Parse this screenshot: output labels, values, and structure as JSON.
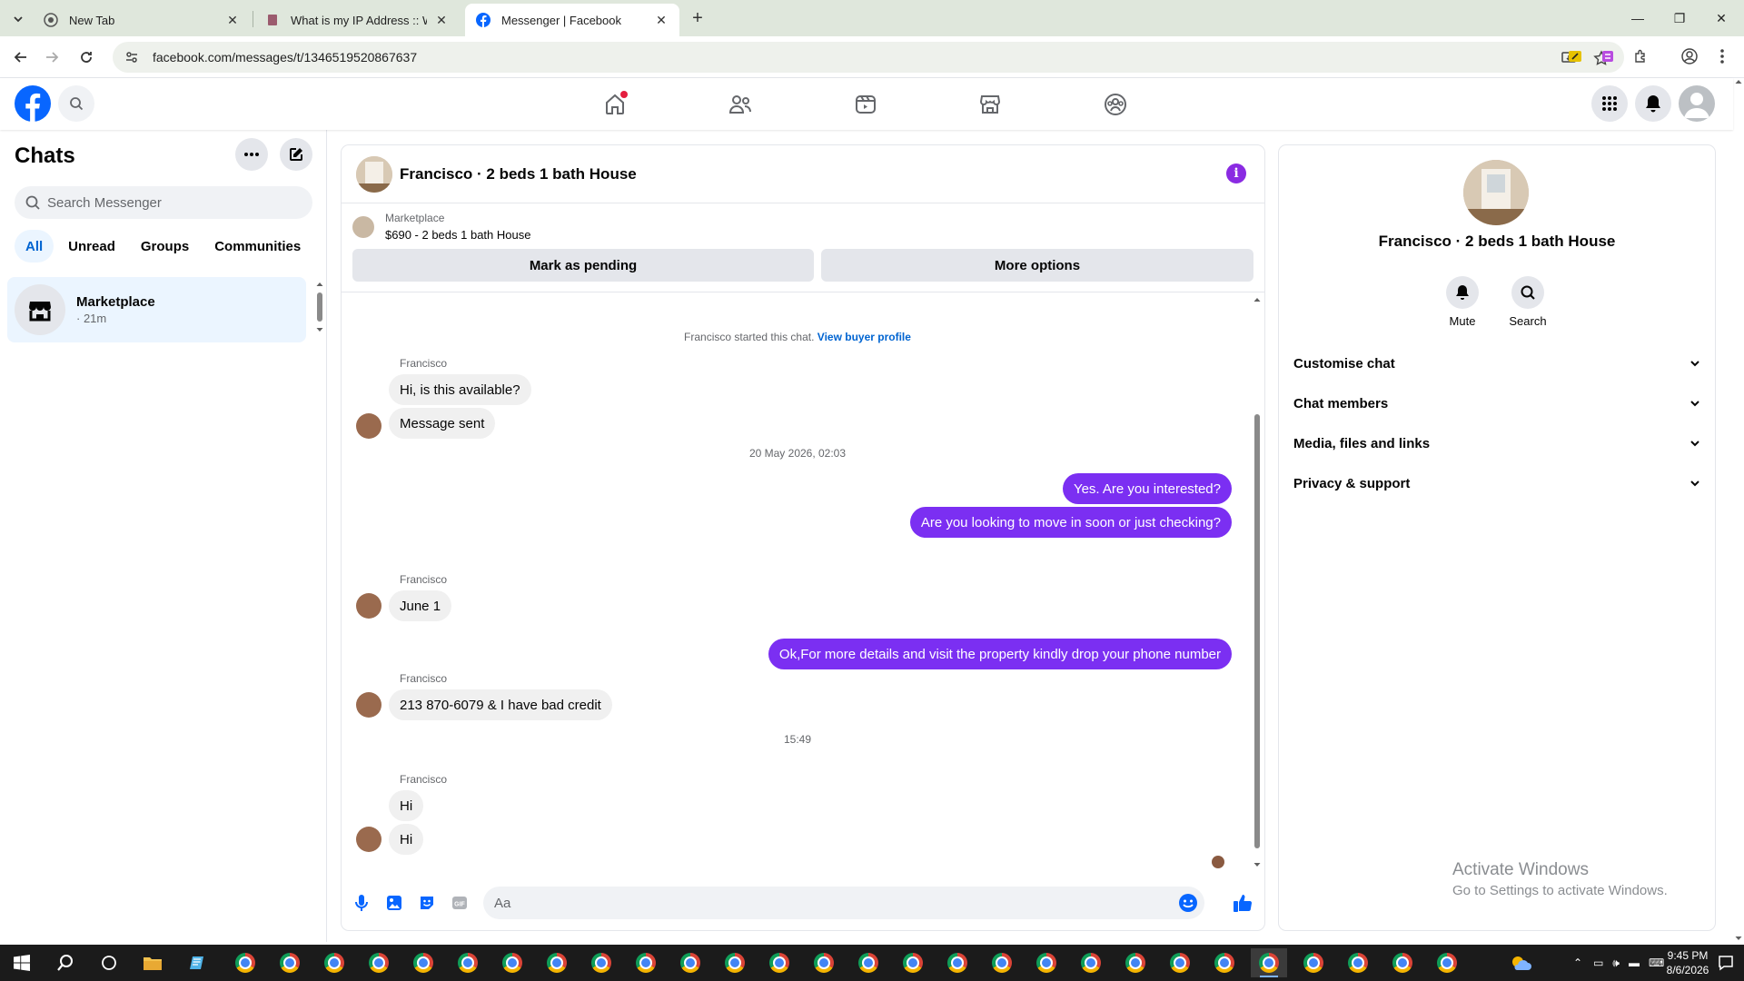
{
  "browser": {
    "tabs": [
      {
        "title": "New Tab",
        "active": false
      },
      {
        "title": "What is my IP Address :: WebBr",
        "active": false
      },
      {
        "title": "Messenger | Facebook",
        "active": true
      }
    ],
    "url": "facebook.com/messages/t/1346519520867637"
  },
  "fb": {
    "nav": [
      "home-icon",
      "friends-icon",
      "video-icon",
      "marketplace-icon",
      "groups-icon"
    ]
  },
  "sidebar": {
    "title": "Chats",
    "search_placeholder": "Search Messenger",
    "filters": [
      "All",
      "Unread",
      "Groups",
      "Communities"
    ],
    "chats": [
      {
        "name": "Marketplace",
        "time": "· 21m"
      }
    ]
  },
  "conversation": {
    "title": "Francisco · 2 beds 1 bath House",
    "marketplace_label": "Marketplace",
    "listing": "$690 - 2 beds 1 bath House",
    "btn_pending": "Mark as pending",
    "btn_more": "More options",
    "started_text": "Francisco started this chat.",
    "buyer_link": "View buyer profile",
    "sender_name": "Francisco",
    "messages": {
      "m1": "Hi, is this available?",
      "m2": "Message sent",
      "ts1": "20 May 2026, 02:03",
      "m3": "Yes. Are you interested?",
      "m4": "Are you looking to move in soon or just checking?",
      "m5": "June 1",
      "m6": "Ok,For more details and visit the property kindly drop your phone number",
      "m7": "213 870-6079 & I have bad credit",
      "ts2": "15:49",
      "m8": "Hi",
      "m9": "Hi"
    },
    "composer_placeholder": "Aa"
  },
  "details": {
    "name": "Francisco · 2 beds 1 bath House",
    "mute": "Mute",
    "search": "Search",
    "sections": [
      "Customise chat",
      "Chat members",
      "Media, files and links",
      "Privacy & support"
    ]
  },
  "watermark": {
    "line1": "Activate Windows",
    "line2": "Go to Settings to activate Windows."
  },
  "taskbar": {
    "time": "9:45 PM",
    "date": "8/6/2026"
  },
  "colors": {
    "accent": "#7b2ff2",
    "fb_blue": "#0866ff",
    "link": "#0064d1"
  }
}
